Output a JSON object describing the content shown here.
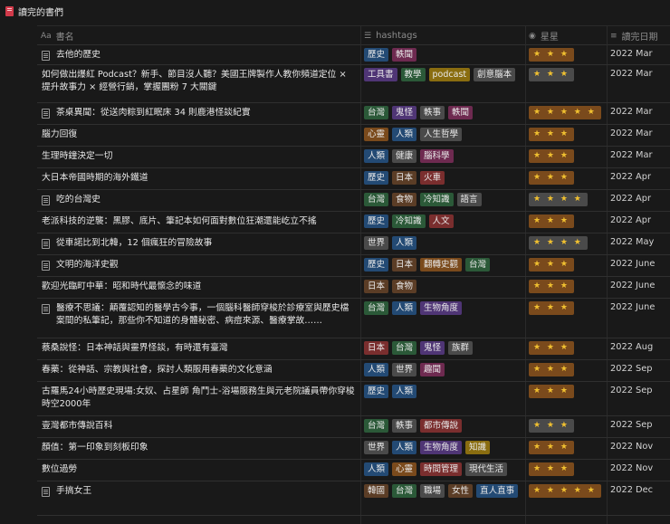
{
  "page": {
    "title": "讀完的書們"
  },
  "columns": {
    "name": "書名",
    "hashtags": "hashtags",
    "stars": "星星",
    "date": "讀完日期"
  },
  "colors": {
    "orange": "#7a4a1c",
    "red": "#7a2e2e",
    "pink": "#6e2a50",
    "purple": "#4f3575",
    "blue": "#234a74",
    "green": "#2b5938",
    "gray": "#4a4a4a",
    "brown": "#5b3d26",
    "yellow": "#6b5a16",
    "gold": "#8a6d10"
  },
  "rows": [
    {
      "name": "去他的歷史",
      "doc": true,
      "h": 22,
      "tags": [
        [
          "歷史",
          "blue"
        ],
        [
          "軼聞",
          "pink"
        ]
      ],
      "stars": "★ ★ ★",
      "star_color": "orange",
      "date": "2022 Mar"
    },
    {
      "name": "如何做出爆紅 Podcast？新手、節目沒人聽？美國王牌製作人教你頻道定位 × 提升故事力 × 經營行銷，掌握團粉 7 大關鍵",
      "doc": false,
      "h": 42,
      "tags": [
        [
          "工具書",
          "purple"
        ],
        [
          "教學",
          "green"
        ],
        [
          "podcast",
          "gold"
        ],
        [
          "創意腦本",
          "gray"
        ]
      ],
      "stars": "★ ★ ★",
      "star_color": "gray",
      "date": "2022 Mar"
    },
    {
      "name": "茶桌異聞：從送肉粽到紅眠床 34 則鹿港怪談紀實",
      "doc": true,
      "h": 24,
      "tags": [
        [
          "台灣",
          "green"
        ],
        [
          "鬼怪",
          "purple"
        ],
        [
          "軼事",
          "gray"
        ],
        [
          "軼聞",
          "pink"
        ]
      ],
      "stars": "★ ★ ★ ★ ★",
      "star_color": "orange",
      "date": "2022 Mar"
    },
    {
      "name": "腦力回復",
      "doc": false,
      "h": 24,
      "tags": [
        [
          "心靈",
          "orange"
        ],
        [
          "人類",
          "blue"
        ],
        [
          "人生哲學",
          "gray"
        ]
      ],
      "stars": "★ ★ ★",
      "star_color": "orange",
      "date": "2022 Mar"
    },
    {
      "name": "生理時鐘決定一切",
      "doc": false,
      "h": 24,
      "tags": [
        [
          "人類",
          "blue"
        ],
        [
          "健康",
          "gray"
        ],
        [
          "腦科學",
          "pink"
        ]
      ],
      "stars": "★ ★ ★",
      "star_color": "orange",
      "date": "2022 Mar"
    },
    {
      "name": "大日本帝國時期的海外鐵道",
      "doc": false,
      "h": 24,
      "tags": [
        [
          "歷史",
          "blue"
        ],
        [
          "日本",
          "brown"
        ],
        [
          "火車",
          "red"
        ]
      ],
      "stars": "★ ★ ★",
      "star_color": "orange",
      "date": "2022 Apr"
    },
    {
      "name": "吃的台灣史",
      "doc": true,
      "h": 24,
      "tags": [
        [
          "台灣",
          "green"
        ],
        [
          "食物",
          "brown"
        ],
        [
          "冷知識",
          "green"
        ],
        [
          "語言",
          "gray"
        ]
      ],
      "stars": "★ ★ ★ ★",
      "star_color": "gray",
      "date": "2022 Apr"
    },
    {
      "name": "老派科技的逆襲：黑膠、底片、筆記本如何面對數位狂潮還能屹立不搖",
      "doc": false,
      "h": 24,
      "tags": [
        [
          "歷史",
          "blue"
        ],
        [
          "冷知識",
          "green"
        ],
        [
          "人文",
          "red"
        ]
      ],
      "stars": "★ ★ ★",
      "star_color": "orange",
      "date": "2022 Apr"
    },
    {
      "name": "從車諾比到北韓，12 個瘋狂的冒險故事",
      "doc": true,
      "h": 24,
      "tags": [
        [
          "世界",
          "gray"
        ],
        [
          "人類",
          "blue"
        ]
      ],
      "stars": "★ ★ ★ ★",
      "star_color": "gray",
      "date": "2022 May"
    },
    {
      "name": "文明的海洋史觀",
      "doc": true,
      "h": 24,
      "tags": [
        [
          "歷史",
          "blue"
        ],
        [
          "日本",
          "brown"
        ],
        [
          "翻轉史觀",
          "orange"
        ],
        [
          "台灣",
          "green"
        ]
      ],
      "stars": "★ ★ ★",
      "star_color": "orange",
      "date": "2022 June"
    },
    {
      "name": "歡迎光臨町中華：昭和時代最懷念的味道",
      "doc": false,
      "h": 24,
      "tags": [
        [
          "日本",
          "brown"
        ],
        [
          "食物",
          "brown"
        ]
      ],
      "stars": "★ ★ ★",
      "star_color": "orange",
      "date": "2022 June"
    },
    {
      "name": "醫療不思議：顛覆認知的醫學古今事，一個腦科醫師穿梭於診療室與歷史檔案間的私筆記，那些你不知道的身體秘密、病痘來源、醫療掌故……",
      "doc": true,
      "h": 44,
      "tags": [
        [
          "台灣",
          "green"
        ],
        [
          "人類",
          "blue"
        ],
        [
          "生物角度",
          "purple"
        ]
      ],
      "stars": "★ ★ ★",
      "star_color": "orange",
      "date": "2022 June"
    },
    {
      "name": "蔡桑說怪：日本神話與靈界怪談，有時還有臺灣",
      "doc": false,
      "h": 24,
      "tags": [
        [
          "日本",
          "red"
        ],
        [
          "台灣",
          "green"
        ],
        [
          "鬼怪",
          "purple"
        ],
        [
          "族群",
          "gray"
        ]
      ],
      "stars": "★ ★ ★",
      "star_color": "orange",
      "date": "2022 Aug"
    },
    {
      "name": "春藥：從神話、宗教與社會，探討人類服用春藥的文化意涵",
      "doc": false,
      "h": 24,
      "tags": [
        [
          "人類",
          "blue"
        ],
        [
          "世界",
          "gray"
        ],
        [
          "趣聞",
          "pink"
        ]
      ],
      "stars": "★ ★ ★",
      "star_color": "orange",
      "date": "2022 Sep"
    },
    {
      "name": "古羅馬24小時歷史現場:女奴、占星師 角鬥士-浴場服務生與元老院議員帶你穿梭時空2000年",
      "doc": false,
      "h": 38,
      "tags": [
        [
          "歷史",
          "blue"
        ],
        [
          "人類",
          "blue"
        ]
      ],
      "stars": "★ ★ ★",
      "star_color": "orange",
      "date": "2022 Sep"
    },
    {
      "name": "壹灣都市傳說百科",
      "doc": false,
      "h": 24,
      "tags": [
        [
          "台灣",
          "green"
        ],
        [
          "軼事",
          "gray"
        ],
        [
          "都市傳說",
          "red"
        ]
      ],
      "stars": "★ ★ ★",
      "star_color": "gray",
      "date": "2022 Sep"
    },
    {
      "name": "顏值：第一印象到刻板印象",
      "doc": false,
      "h": 24,
      "tags": [
        [
          "世界",
          "gray"
        ],
        [
          "人類",
          "blue"
        ],
        [
          "生物角度",
          "purple"
        ],
        [
          "知識",
          "gold"
        ]
      ],
      "stars": "★ ★ ★",
      "star_color": "orange",
      "date": "2022 Nov"
    },
    {
      "name": "數位過勞",
      "doc": false,
      "h": 24,
      "tags": [
        [
          "人類",
          "blue"
        ],
        [
          "心靈",
          "orange"
        ],
        [
          "時間管理",
          "red"
        ],
        [
          "現代生活",
          "gray"
        ]
      ],
      "stars": "★ ★ ★",
      "star_color": "orange",
      "date": "2022 Nov"
    },
    {
      "name": "手搞女王",
      "doc": true,
      "h": 38,
      "tags": [
        [
          "韓國",
          "brown"
        ],
        [
          "台灣",
          "green"
        ],
        [
          "職場",
          "gray"
        ],
        [
          "女性",
          "brown"
        ],
        [
          "直人直事",
          "blue"
        ]
      ],
      "stars": "★ ★ ★ ★ ★",
      "star_color": "orange",
      "date": "2022 Dec"
    }
  ]
}
